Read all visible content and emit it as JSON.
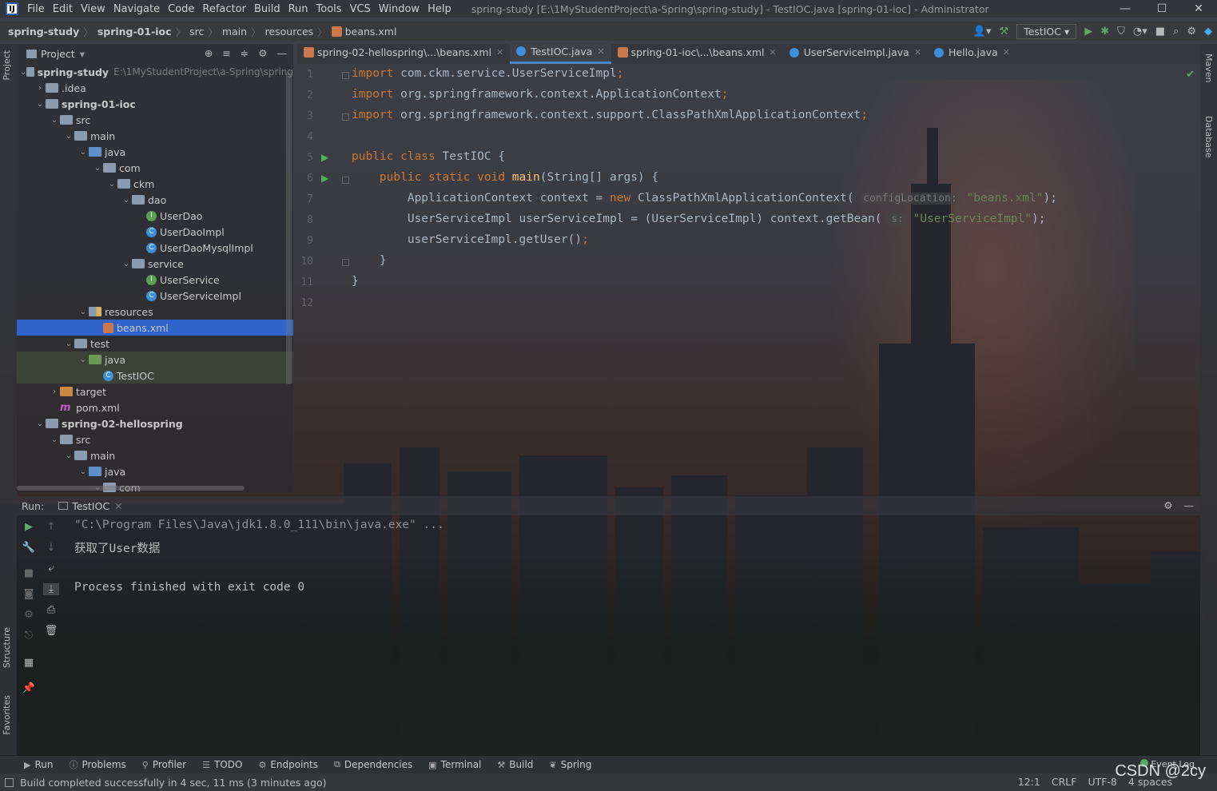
{
  "window": {
    "title": "spring-study [E:\\1MyStudentProject\\a-Spring\\spring-study] - TestIOC.java [spring-01-ioc] - Administrator",
    "menu": [
      "File",
      "Edit",
      "View",
      "Navigate",
      "Code",
      "Refactor",
      "Build",
      "Run",
      "Tools",
      "VCS",
      "Window",
      "Help"
    ],
    "controls": {
      "minimize": "—",
      "maximize": "☐",
      "close": "✕"
    },
    "logo": "IJ"
  },
  "breadcrumb": [
    "spring-study",
    "spring-01-ioc",
    "src",
    "main",
    "resources",
    "beans.xml"
  ],
  "toolbar": {
    "run_config": "TestIOC"
  },
  "left_strip": {
    "project": "Project",
    "structure": "Structure",
    "favorites": "Favorites"
  },
  "right_strip": {
    "maven": "Maven",
    "database": "Database"
  },
  "project_panel": {
    "title": "Project",
    "tree": [
      {
        "label": "spring-study",
        "path": "E:\\1MyStudentProject\\a-Spring\\spring",
        "indent": 0,
        "arrow": "v",
        "icon": "module",
        "bold": true
      },
      {
        "label": ".idea",
        "indent": 1,
        "arrow": ">",
        "icon": "folder"
      },
      {
        "label": "spring-01-ioc",
        "indent": 1,
        "arrow": "v",
        "icon": "module",
        "bold": true
      },
      {
        "label": "src",
        "indent": 2,
        "arrow": "v",
        "icon": "folder"
      },
      {
        "label": "main",
        "indent": 3,
        "arrow": "v",
        "icon": "folder"
      },
      {
        "label": "java",
        "indent": 4,
        "arrow": "v",
        "icon": "folder-blue"
      },
      {
        "label": "com",
        "indent": 5,
        "arrow": "v",
        "icon": "folder"
      },
      {
        "label": "ckm",
        "indent": 6,
        "arrow": "v",
        "icon": "folder"
      },
      {
        "label": "dao",
        "indent": 7,
        "arrow": "v",
        "icon": "folder"
      },
      {
        "label": "UserDao",
        "indent": 8,
        "arrow": "",
        "icon": "interface"
      },
      {
        "label": "UserDaoImpl",
        "indent": 8,
        "arrow": "",
        "icon": "class"
      },
      {
        "label": "UserDaoMysqlImpl",
        "indent": 8,
        "arrow": "",
        "icon": "class"
      },
      {
        "label": "service",
        "indent": 7,
        "arrow": "v",
        "icon": "folder"
      },
      {
        "label": "UserService",
        "indent": 8,
        "arrow": "",
        "icon": "interface"
      },
      {
        "label": "UserServiceImpl",
        "indent": 8,
        "arrow": "",
        "icon": "class"
      },
      {
        "label": "resources",
        "indent": 4,
        "arrow": "v",
        "icon": "folder-res"
      },
      {
        "label": "beans.xml",
        "indent": 5,
        "arrow": "",
        "icon": "xml",
        "selected": true
      },
      {
        "label": "test",
        "indent": 3,
        "arrow": "v",
        "icon": "folder"
      },
      {
        "label": "java",
        "indent": 4,
        "arrow": "v",
        "icon": "folder-green",
        "test": true
      },
      {
        "label": "TestIOC",
        "indent": 5,
        "arrow": "",
        "icon": "class",
        "test": true
      },
      {
        "label": "target",
        "indent": 2,
        "arrow": ">",
        "icon": "folder-orange"
      },
      {
        "label": "pom.xml",
        "indent": 2,
        "arrow": "",
        "icon": "maven"
      },
      {
        "label": "spring-02-hellospring",
        "indent": 1,
        "arrow": "v",
        "icon": "module",
        "bold": true
      },
      {
        "label": "src",
        "indent": 2,
        "arrow": "v",
        "icon": "folder"
      },
      {
        "label": "main",
        "indent": 3,
        "arrow": "v",
        "icon": "folder"
      },
      {
        "label": "java",
        "indent": 4,
        "arrow": "v",
        "icon": "folder-blue"
      },
      {
        "label": "com",
        "indent": 5,
        "arrow": "v",
        "icon": "folder"
      }
    ]
  },
  "editor": {
    "tabs": [
      {
        "label": "spring-02-hellospring\\...\\beans.xml",
        "icon": "xml",
        "active": false
      },
      {
        "label": "TestIOC.java",
        "icon": "class",
        "active": true
      },
      {
        "label": "spring-01-ioc\\...\\beans.xml",
        "icon": "xml",
        "active": false
      },
      {
        "label": "UserServiceImpl.java",
        "icon": "class",
        "active": false
      },
      {
        "label": "Hello.java",
        "icon": "class",
        "active": false
      }
    ],
    "line_numbers": [
      "1",
      "2",
      "3",
      "4",
      "5",
      "6",
      "7",
      "8",
      "9",
      "10",
      "11",
      "12"
    ],
    "code": [
      [
        {
          "t": "import ",
          "c": "kw"
        },
        {
          "t": "com.ckm.service.UserServiceImpl"
        },
        {
          "t": ";",
          "c": "kw"
        }
      ],
      [
        {
          "t": "import ",
          "c": "kw"
        },
        {
          "t": "org.springframework.context.ApplicationContext"
        },
        {
          "t": ";",
          "c": "kw"
        }
      ],
      [
        {
          "t": "import ",
          "c": "kw"
        },
        {
          "t": "org.springframework.context.support.ClassPathXmlApplicationContext"
        },
        {
          "t": ";",
          "c": "kw"
        }
      ],
      [],
      [
        {
          "t": "public class ",
          "c": "kw"
        },
        {
          "t": "TestIOC {"
        }
      ],
      [
        {
          "t": "    "
        },
        {
          "t": "public static void ",
          "c": "kw"
        },
        {
          "t": "main",
          "c": "fn"
        },
        {
          "t": "(String[] args) {"
        }
      ],
      [
        {
          "t": "        ApplicationContext context = "
        },
        {
          "t": "new ",
          "c": "kw"
        },
        {
          "t": "ClassPathXmlApplicationContext( "
        },
        {
          "t": "configLocation:",
          "c": "hint"
        },
        {
          "t": " "
        },
        {
          "t": "\"beans.xml\"",
          "c": "str"
        },
        {
          "t": ");"
        }
      ],
      [
        {
          "t": "        UserServiceImpl userServiceImpl = (UserServiceImpl) context.getBean( "
        },
        {
          "t": "s:",
          "c": "hint"
        },
        {
          "t": " "
        },
        {
          "t": "\"UserServiceImpl\"",
          "c": "str"
        },
        {
          "t": ");"
        }
      ],
      [
        {
          "t": "        userServiceImpl.getUser()"
        },
        {
          "t": ";",
          "c": "kw"
        }
      ],
      [
        {
          "t": "    }"
        }
      ],
      [
        {
          "t": "}"
        }
      ],
      []
    ]
  },
  "run_panel": {
    "label": "Run:",
    "tab": "TestIOC",
    "output": [
      "\"C:\\Program Files\\Java\\jdk1.8.0_111\\bin\\java.exe\" ...",
      "获取了User数据",
      "",
      "Process finished with exit code 0"
    ]
  },
  "tool_windows": [
    "Run",
    "Problems",
    "Profiler",
    "TODO",
    "Endpoints",
    "Dependencies",
    "Terminal",
    "Build",
    "Spring"
  ],
  "event_log": "Event Log",
  "status": {
    "message": "Build completed successfully in 4 sec, 11 ms (3 minutes ago)",
    "position": "12:1",
    "line_sep": "CRLF",
    "encoding": "UTF-8",
    "indent": "4 spaces"
  },
  "watermark": "CSDN @2cy",
  "colors": {
    "accent": "#2f65ca",
    "keyword": "#cc7832",
    "string": "#6a8759",
    "function": "#ffc66d",
    "run_green": "#4fb155"
  }
}
